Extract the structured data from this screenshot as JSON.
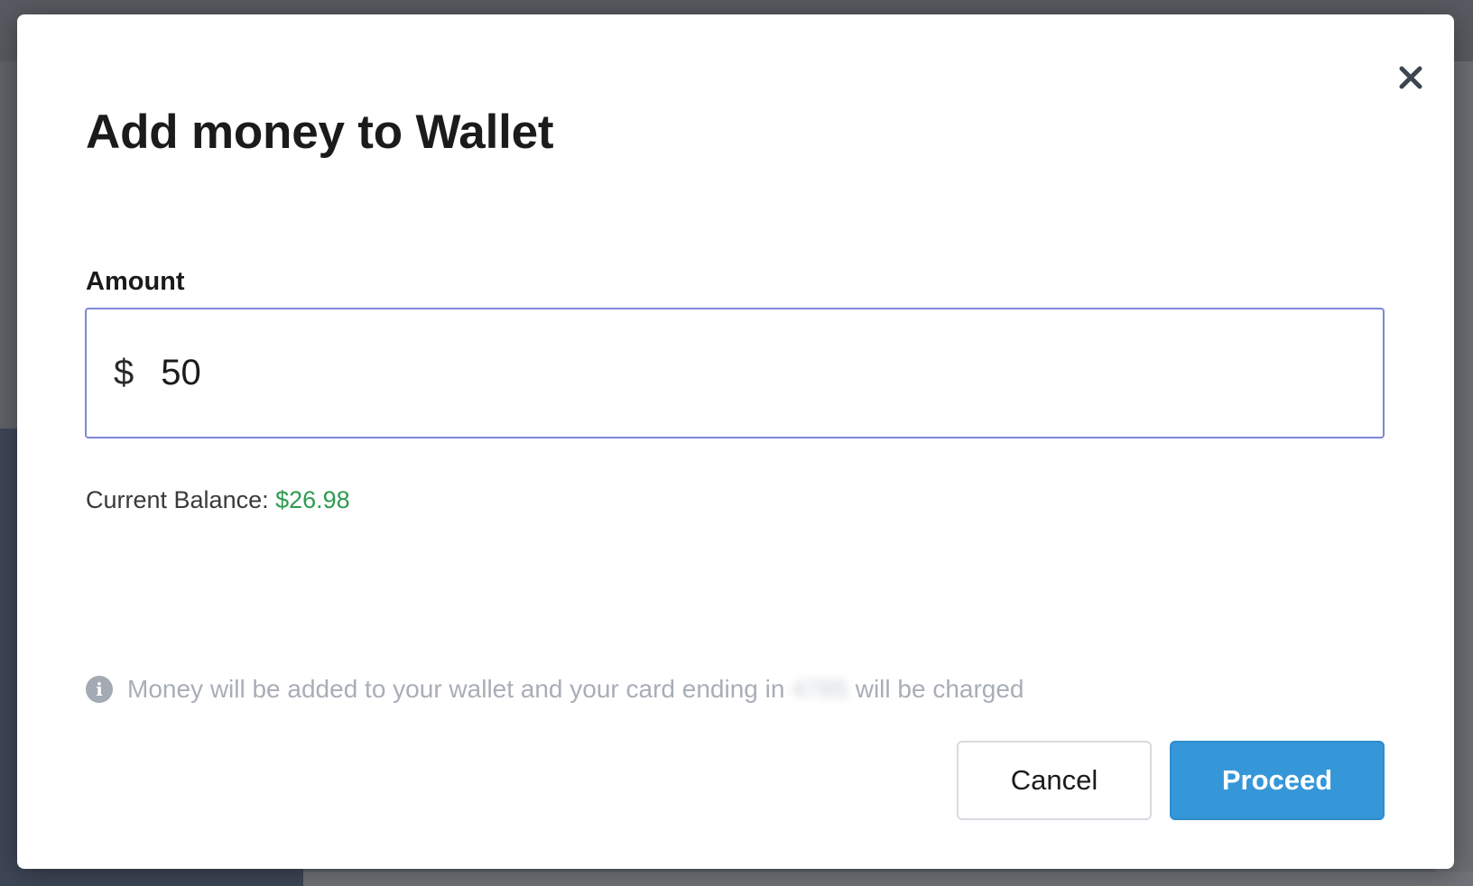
{
  "modal": {
    "title": "Add money to Wallet",
    "close_icon": "close-icon"
  },
  "amount": {
    "label": "Amount",
    "currency_symbol": "$",
    "value": "50"
  },
  "balance": {
    "label": "Current Balance: ",
    "amount": "$26.98",
    "amount_color": "#2e9b4f"
  },
  "info": {
    "icon": "info-icon",
    "text_before": "Money will be added to your wallet and your card ending in",
    "card_last_digits": "4785",
    "text_after": "will be charged"
  },
  "actions": {
    "cancel_label": "Cancel",
    "proceed_label": "Proceed",
    "proceed_color": "#3597d8"
  }
}
